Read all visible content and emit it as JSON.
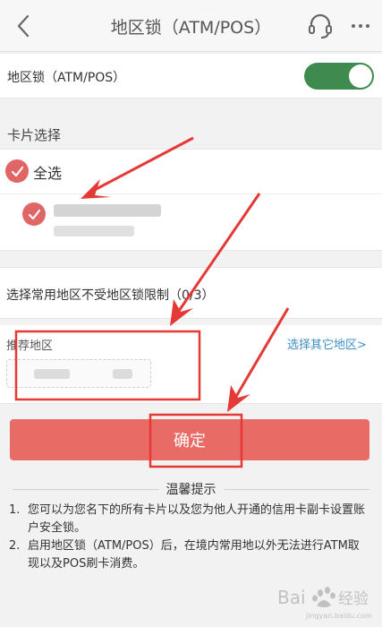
{
  "header": {
    "title": "地区锁（ATM/POS）",
    "back_icon": "chevron-left-icon",
    "support_icon": "headset-icon",
    "more_icon": "more-icon"
  },
  "region_lock": {
    "label": "地区锁（ATM/POS）",
    "enabled": true,
    "toggle_color": "#3f8a4e"
  },
  "card_section": {
    "title": "卡片选择",
    "select_all_label": "全选",
    "select_all_checked": true,
    "cards": [
      {
        "checked": true
      }
    ]
  },
  "common_regions": {
    "label": "选择常用地区不受地区锁限制（0/3）"
  },
  "recommended": {
    "label": "推荐地区",
    "other_link": "选择其它地区>"
  },
  "confirm_button": {
    "label": "确定",
    "color": "#e96b66"
  },
  "tips": {
    "title": "温馨提示",
    "items": [
      {
        "num": "1.",
        "text": "您可以为您名下的所有卡片以及您为他人开通的信用卡副卡设置账户安全锁。"
      },
      {
        "num": "2.",
        "text": "启用地区锁（ATM/POS）后，在境内常用地以外无法进行ATM取现以及POS刷卡消费。"
      }
    ]
  },
  "watermark": {
    "text": "Bai 经验",
    "subtext": "jingyan.baidu.com"
  },
  "annotation_color": "#e53935"
}
